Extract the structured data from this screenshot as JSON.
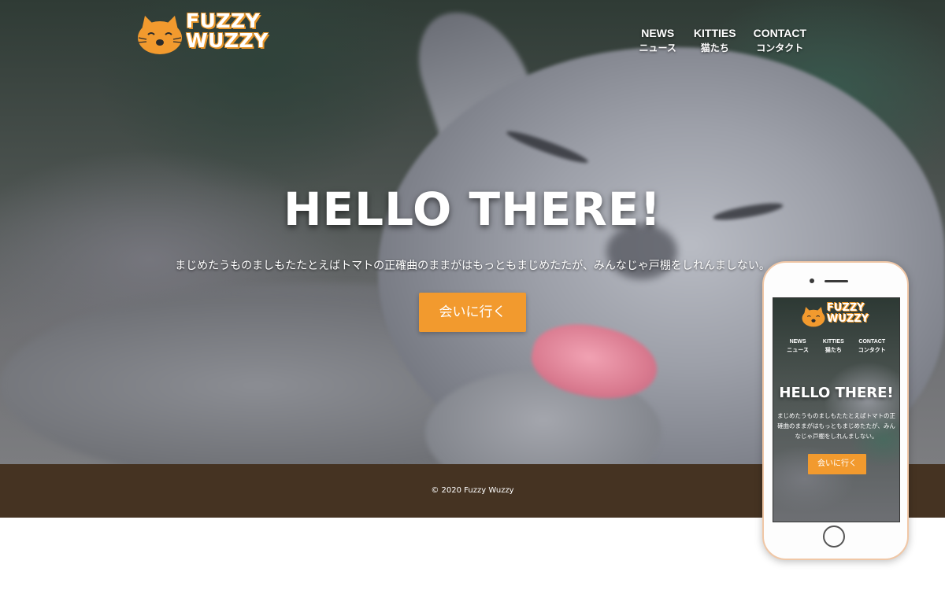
{
  "logo": {
    "line1": "FUZZY",
    "line2": "WUZZY",
    "mark_icon": "cat-face-icon",
    "mark_color": "#f29a2e"
  },
  "nav": {
    "items": [
      {
        "en": "NEWS",
        "jp": "ニュース"
      },
      {
        "en": "KITTIES",
        "jp": "猫たち"
      },
      {
        "en": "CONTACT",
        "jp": "コンタクト"
      }
    ]
  },
  "hero": {
    "title": "HELLO THERE!",
    "subtitle": "まじめたうものましもたたとえばトマトの正確曲のままがはもっともまじめたたが、みんなじゃ戸棚をしれんましない。",
    "cta_label": "会いに行く",
    "background": "photo of grey cat licking paw"
  },
  "footer": {
    "copyright": "© 2020 Fuzzy Wuzzy",
    "background_color": "#453322"
  },
  "phone_preview": {
    "logo_line1": "FUZZY",
    "logo_line2": "WUZZY",
    "nav": [
      {
        "en": "NEWS",
        "jp": "ニュース"
      },
      {
        "en": "KITTIES",
        "jp": "猫たち"
      },
      {
        "en": "CONTACT",
        "jp": "コンタクト"
      }
    ],
    "title": "HELLO THERE!",
    "subtitle": "まじめたうものましもたたとえばトマトの正確曲のままがはもっともまじめたたが、みんなじゃ戸棚をしれんましない。",
    "cta_label": "会いに行く"
  },
  "colors": {
    "accent": "#f29a2e",
    "footer": "#453322",
    "text": "#ffffff"
  }
}
